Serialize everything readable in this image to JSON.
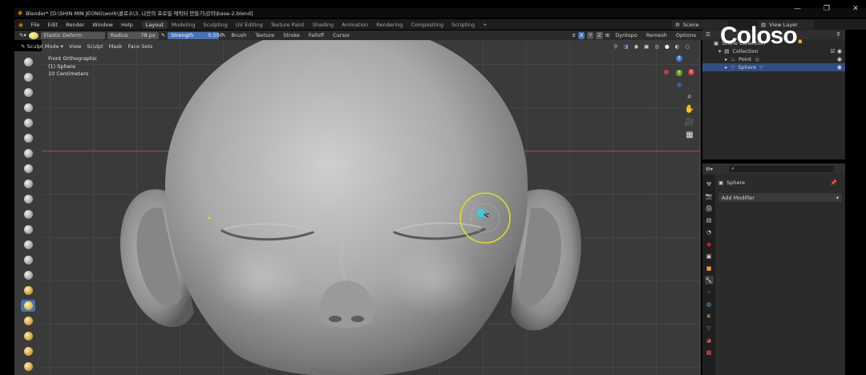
{
  "window": {
    "title": "Blender* [D:\\SHIN MIN JEONG\\work\\콜로소\\3. 나만의 프로필 캐릭터 만들기\\강의\\base-2.blend]",
    "controls": [
      "minimize-icon",
      "restore-icon",
      "close-icon"
    ]
  },
  "menu": {
    "items": [
      "File",
      "Edit",
      "Render",
      "Window",
      "Help"
    ]
  },
  "workspaces": {
    "tabs": [
      "Layout",
      "Modeling",
      "Sculpting",
      "UV Editing",
      "Texture Paint",
      "Shading",
      "Animation",
      "Rendering",
      "Compositing",
      "Scripting"
    ],
    "active": "Layout",
    "add": "+"
  },
  "scene": {
    "label": "Scene",
    "view_layer": "View Layer"
  },
  "toolheader": {
    "brush_name": "Elastic Deform",
    "radius_label": "Radius",
    "radius_value": "78 px",
    "strength_label": "Strength",
    "strength_value": "0.500",
    "menus": [
      "Brush",
      "Texture",
      "Stroke",
      "Falloff",
      "Cursor"
    ],
    "axes": [
      "X",
      "Y",
      "Z"
    ],
    "dyntopo": "Dyntopo",
    "remesh": "Remesh",
    "options": "Options"
  },
  "viewport": {
    "mode": "Sculpt Mode",
    "menus": [
      "View",
      "Sculpt",
      "Mask",
      "Face Sets"
    ],
    "info": [
      "Front Orthographic",
      "(1) Sphere",
      "10 Centimeters"
    ],
    "gizmo": {
      "x": "X",
      "y": "Y",
      "z": "Z"
    },
    "brush_color": "#c8d23a"
  },
  "outliner": {
    "title": "Scene Collection",
    "rows": [
      {
        "label": "Collection",
        "indent": 1
      },
      {
        "label": "Point",
        "indent": 2
      },
      {
        "label": "Sphere",
        "indent": 2,
        "selected": true
      }
    ]
  },
  "properties": {
    "object": "Sphere",
    "add_modifier": "Add Modifier"
  },
  "logo": {
    "text": "Coloso",
    "dot": "."
  },
  "colors": {
    "accent": "#4772b3",
    "selection": "#334d80",
    "background": "#3a3a3a"
  }
}
